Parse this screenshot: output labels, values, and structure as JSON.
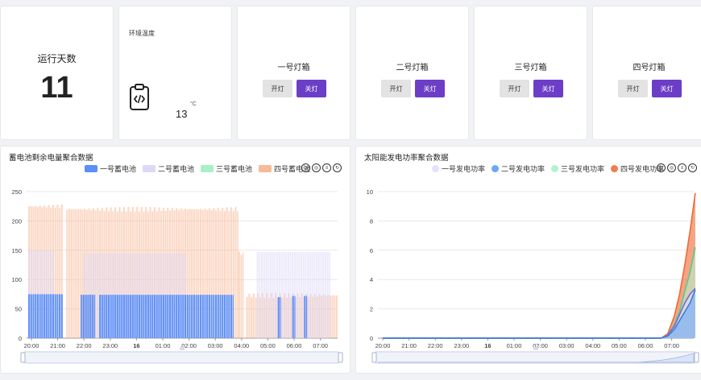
{
  "summary": {
    "days_label": "运行天数",
    "days_value": "11"
  },
  "environment": {
    "title": "环境温度",
    "value": "13",
    "unit": "°C",
    "icon": "thermometer-code-icon"
  },
  "lamps": [
    {
      "title": "一号灯箱",
      "on_label": "开灯",
      "off_label": "关灯"
    },
    {
      "title": "二号灯箱",
      "on_label": "开灯",
      "off_label": "关灯"
    },
    {
      "title": "三号灯箱",
      "on_label": "开灯",
      "off_label": "关灯"
    },
    {
      "title": "四号灯箱",
      "on_label": "开灯",
      "off_label": "关灯"
    }
  ],
  "colors": {
    "accent": "#6c3ec7",
    "battery1": "#5b8ff9",
    "battery2": "#ddd8f6",
    "battery3": "#a9f0c6",
    "battery4": "#f9b896",
    "solar1": "#e4e1fa",
    "solar2": "#6aa8f7",
    "solar3": "#b3f2cd",
    "solar4": "#f07d50"
  },
  "battery_chart": {
    "title": "蓄电池剩余电量聚合数据",
    "legend": [
      "一号蓄电池",
      "二号蓄电池",
      "三号蓄电池",
      "四号蓄电池"
    ],
    "tool_icons": [
      "clock-icon",
      "target-icon",
      "filter-icon",
      "refresh-icon"
    ]
  },
  "solar_chart": {
    "title": "太阳能发电功率聚合数据",
    "legend": [
      "一号发电功率",
      "二号发电功率",
      "三号发电功率",
      "四号发电功率"
    ],
    "tool_icons": [
      "clock-icon",
      "target-icon",
      "filter-icon",
      "refresh-icon"
    ]
  },
  "chart_data": [
    {
      "type": "bar",
      "title": "蓄电池剩余电量聚合数据",
      "x_ticks": [
        "20:00",
        "21:00",
        "22:00",
        "23:00",
        "16",
        "01:00",
        "02:00",
        "03:00",
        "04:00",
        "05:00",
        "06:00",
        "07:00"
      ],
      "ylim": [
        0,
        250
      ],
      "y_ticks": [
        0,
        50,
        100,
        150,
        200,
        250
      ],
      "series": [
        {
          "name": "一号蓄电池",
          "segments": [
            {
              "from": 0.0,
              "to": 1.33,
              "value": 75
            },
            {
              "from": 2.0,
              "to": 2.55,
              "value": 74
            },
            {
              "from": 2.7,
              "to": 7.8,
              "value": 74
            },
            {
              "from": 9.5,
              "to": 9.6,
              "value": 70
            },
            {
              "from": 10.05,
              "to": 10.15,
              "value": 72
            },
            {
              "from": 10.5,
              "to": 10.6,
              "value": 72
            }
          ]
        },
        {
          "name": "二号蓄电池",
          "segments": [
            {
              "from": 0.0,
              "to": 1.0,
              "value": 150
            },
            {
              "from": 2.1,
              "to": 6.0,
              "value": 145
            },
            {
              "from": 8.7,
              "to": 11.5,
              "value": 147
            }
          ]
        },
        {
          "name": "三号蓄电池",
          "segments": []
        },
        {
          "name": "四号蓄电池",
          "segments": [
            {
              "from": 0.0,
              "to": 1.33,
              "value": 225
            },
            {
              "from": 1.45,
              "to": 8.0,
              "value": 220
            },
            {
              "from": 8.0,
              "to": 8.2,
              "value": 145
            },
            {
              "from": 8.3,
              "to": 11.8,
              "value": 73
            }
          ]
        }
      ]
    },
    {
      "type": "area",
      "title": "太阳能发电功率聚合数据",
      "x_ticks": [
        "20:00",
        "21:00",
        "22:00",
        "23:00",
        "16",
        "01:00",
        "02:00",
        "03:00",
        "04:00",
        "05:00",
        "06:00",
        "07:00"
      ],
      "ylim": [
        0,
        10
      ],
      "y_ticks": [
        0,
        2,
        4,
        6,
        8,
        10
      ],
      "x": [
        0,
        10.6,
        10.85,
        11.1,
        11.3,
        11.5,
        11.7,
        11.9
      ],
      "series": [
        {
          "name": "一号发电功率",
          "values": [
            0,
            0,
            0.2,
            0.8,
            1.6,
            2.4,
            3.0,
            3.4
          ]
        },
        {
          "name": "二号发电功率",
          "values": [
            0,
            0,
            0.15,
            0.6,
            1.2,
            1.8,
            2.4,
            3.3
          ]
        },
        {
          "name": "三号发电功率",
          "values": [
            0,
            0,
            0.2,
            0.9,
            1.8,
            3.2,
            4.5,
            6.2
          ]
        },
        {
          "name": "四号发电功率",
          "values": [
            0,
            0,
            0.3,
            1.5,
            3.0,
            5.0,
            7.3,
            9.9
          ]
        }
      ]
    }
  ]
}
